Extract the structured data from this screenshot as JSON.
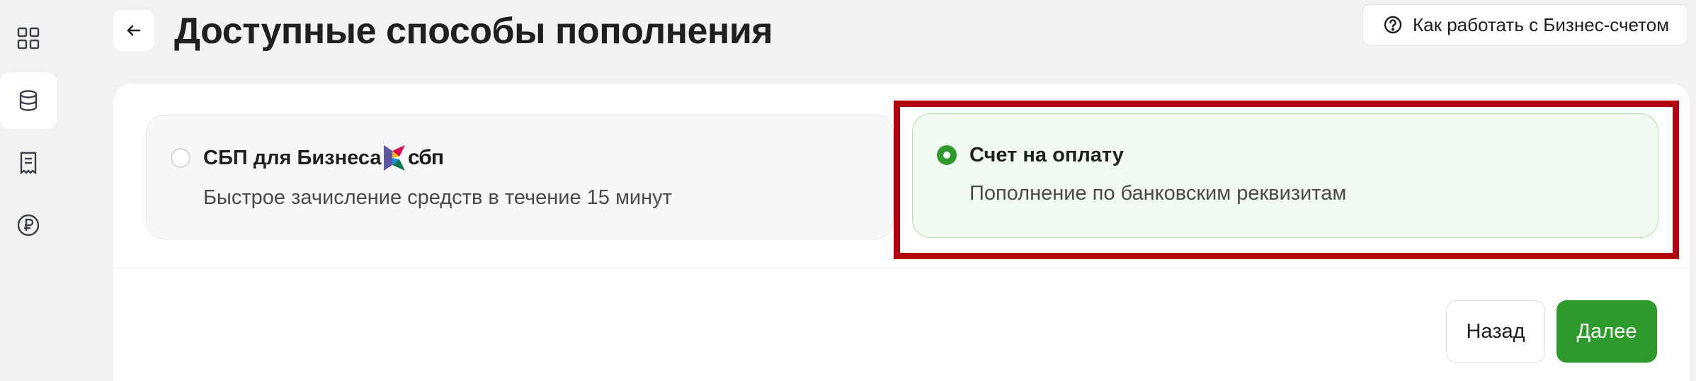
{
  "header": {
    "title": "Доступные способы пополнения",
    "help_label": "Как работать с Бизнес-счетом"
  },
  "sidebar": {
    "items": [
      {
        "icon": "grid-icon",
        "active": false
      },
      {
        "icon": "database-icon",
        "active": true
      },
      {
        "icon": "document-icon",
        "active": false
      },
      {
        "icon": "ruble-icon",
        "active": false
      }
    ]
  },
  "options": [
    {
      "title": "СБП для Бизнеса",
      "description": "Быстрое зачисление средств в течение 15 минут",
      "logo_text": "сбп",
      "selected": false
    },
    {
      "title": "Счет на оплату",
      "description": "Пополнение по банковским реквизитам",
      "selected": true
    }
  ],
  "footer": {
    "back_label": "Назад",
    "next_label": "Далее"
  },
  "colors": {
    "accent": "#2e9a2b",
    "highlight": "#b3000f",
    "background": "#f2f2f2"
  }
}
